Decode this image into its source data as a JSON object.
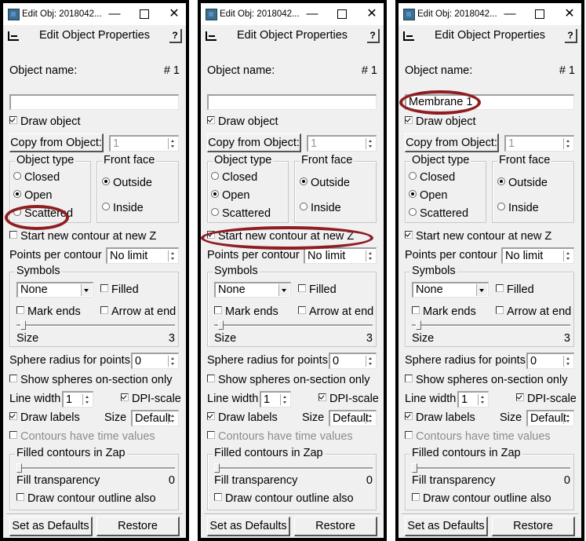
{
  "windows": [
    {
      "title": "Edit Obj: 2018042...",
      "header_title": "Edit Object Properties",
      "help_label": "?",
      "object_name_label": "Object name:",
      "object_number": "# 1",
      "object_name_value": "",
      "draw_object": {
        "label": "Draw object",
        "checked": true
      },
      "copy_from_button": "Copy from Object:",
      "copy_from_value": "1",
      "object_type": {
        "legend": "Object type",
        "options": [
          "Closed",
          "Open",
          "Scattered"
        ],
        "selected": "Open"
      },
      "front_face": {
        "legend": "Front face",
        "options": [
          "Outside",
          "Inside"
        ],
        "selected": "Outside"
      },
      "start_new_contour": {
        "label": "Start new contour at new Z",
        "checked": false
      },
      "points_per_contour": {
        "label": "Points per contour",
        "value": "No limit"
      },
      "symbols": {
        "legend": "Symbols",
        "combo_value": "None",
        "filled_label": "Filled",
        "filled": false,
        "mark_ends_label": "Mark ends",
        "mark_ends": false,
        "arrow_label": "Arrow at end",
        "arrow": false,
        "size_label": "Size",
        "size_value": "3"
      },
      "sphere_radius": {
        "label": "Sphere radius for points",
        "value": "0"
      },
      "show_spheres": {
        "label": "Show spheres on-section only",
        "checked": false
      },
      "line_width": {
        "label": "Line width",
        "value": "1"
      },
      "dpi_scale": {
        "label": "DPI-scale",
        "checked": true
      },
      "draw_labels": {
        "label": "Draw labels",
        "checked": true
      },
      "label_size": {
        "label": "Size",
        "value": "Default"
      },
      "time_values": {
        "label": "Contours have time values",
        "checked": false
      },
      "filled_contours": {
        "legend": "Filled contours in Zap",
        "fill_label": "Fill transparency",
        "fill_value": "0",
        "outline_label": "Draw contour outline also",
        "outline": false
      },
      "set_defaults_button": "Set as Defaults",
      "restore_button": "Restore",
      "annotation": "object-type-open"
    },
    {
      "title": "Edit Obj: 2018042...",
      "header_title": "Edit Object Properties",
      "help_label": "?",
      "object_name_label": "Object name:",
      "object_number": "# 1",
      "object_name_value": "",
      "draw_object": {
        "label": "Draw object",
        "checked": true
      },
      "copy_from_button": "Copy from Object:",
      "copy_from_value": "1",
      "object_type": {
        "legend": "Object type",
        "options": [
          "Closed",
          "Open",
          "Scattered"
        ],
        "selected": "Open"
      },
      "front_face": {
        "legend": "Front face",
        "options": [
          "Outside",
          "Inside"
        ],
        "selected": "Outside"
      },
      "start_new_contour": {
        "label": "Start new contour at new Z",
        "checked": true
      },
      "points_per_contour": {
        "label": "Points per contour",
        "value": "No limit"
      },
      "symbols": {
        "legend": "Symbols",
        "combo_value": "None",
        "filled_label": "Filled",
        "filled": false,
        "mark_ends_label": "Mark ends",
        "mark_ends": false,
        "arrow_label": "Arrow at end",
        "arrow": false,
        "size_label": "Size",
        "size_value": "3"
      },
      "sphere_radius": {
        "label": "Sphere radius for points",
        "value": "0"
      },
      "show_spheres": {
        "label": "Show spheres on-section only",
        "checked": false
      },
      "line_width": {
        "label": "Line width",
        "value": "1"
      },
      "dpi_scale": {
        "label": "DPI-scale",
        "checked": true
      },
      "draw_labels": {
        "label": "Draw labels",
        "checked": true
      },
      "label_size": {
        "label": "Size",
        "value": "Default"
      },
      "time_values": {
        "label": "Contours have time values",
        "checked": false
      },
      "filled_contours": {
        "legend": "Filled contours in Zap",
        "fill_label": "Fill transparency",
        "fill_value": "0",
        "outline_label": "Draw contour outline also",
        "outline": false
      },
      "set_defaults_button": "Set as Defaults",
      "restore_button": "Restore",
      "annotation": "start-new-contour"
    },
    {
      "title": "Edit Obj: 2018042...",
      "header_title": "Edit Object Properties",
      "help_label": "?",
      "object_name_label": "Object name:",
      "object_number": "# 1",
      "object_name_value": "Membrane 1",
      "draw_object": {
        "label": "Draw object",
        "checked": true
      },
      "copy_from_button": "Copy from Object:",
      "copy_from_value": "1",
      "object_type": {
        "legend": "Object type",
        "options": [
          "Closed",
          "Open",
          "Scattered"
        ],
        "selected": "Open"
      },
      "front_face": {
        "legend": "Front face",
        "options": [
          "Outside",
          "Inside"
        ],
        "selected": "Outside"
      },
      "start_new_contour": {
        "label": "Start new contour at new Z",
        "checked": true
      },
      "points_per_contour": {
        "label": "Points per contour",
        "value": "No limit"
      },
      "symbols": {
        "legend": "Symbols",
        "combo_value": "None",
        "filled_label": "Filled",
        "filled": false,
        "mark_ends_label": "Mark ends",
        "mark_ends": false,
        "arrow_label": "Arrow at end",
        "arrow": false,
        "size_label": "Size",
        "size_value": "3"
      },
      "sphere_radius": {
        "label": "Sphere radius for points",
        "value": "0"
      },
      "show_spheres": {
        "label": "Show spheres on-section only",
        "checked": false
      },
      "line_width": {
        "label": "Line width",
        "value": "1"
      },
      "dpi_scale": {
        "label": "DPI-scale",
        "checked": true
      },
      "draw_labels": {
        "label": "Draw labels",
        "checked": true
      },
      "label_size": {
        "label": "Size",
        "value": "Default"
      },
      "time_values": {
        "label": "Contours have time values",
        "checked": false
      },
      "filled_contours": {
        "legend": "Filled contours in Zap",
        "fill_label": "Fill transparency",
        "fill_value": "0",
        "outline_label": "Draw contour outline also",
        "outline": false
      },
      "set_defaults_button": "Set as Defaults",
      "restore_button": "Restore",
      "annotation": "object-name"
    }
  ],
  "annotation_color": "#8e1e22",
  "window_controls": {
    "minimize": "—",
    "close": "✕"
  }
}
